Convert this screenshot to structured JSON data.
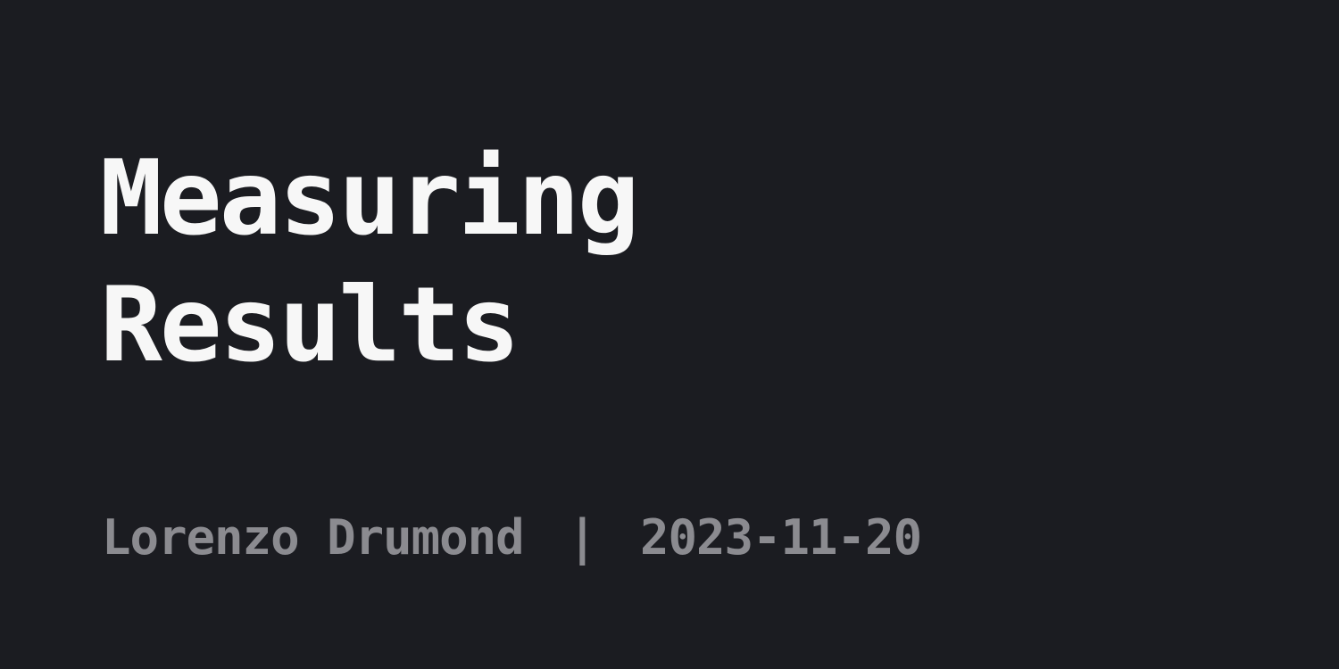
{
  "title": {
    "line1": "Measuring",
    "line2": "Results"
  },
  "meta": {
    "author": "Lorenzo Drumond",
    "separator": "|",
    "date": "2023-11-20"
  },
  "colors": {
    "background": "#1b1c21",
    "title": "#f7f7f7",
    "meta": "#8b8b90"
  }
}
